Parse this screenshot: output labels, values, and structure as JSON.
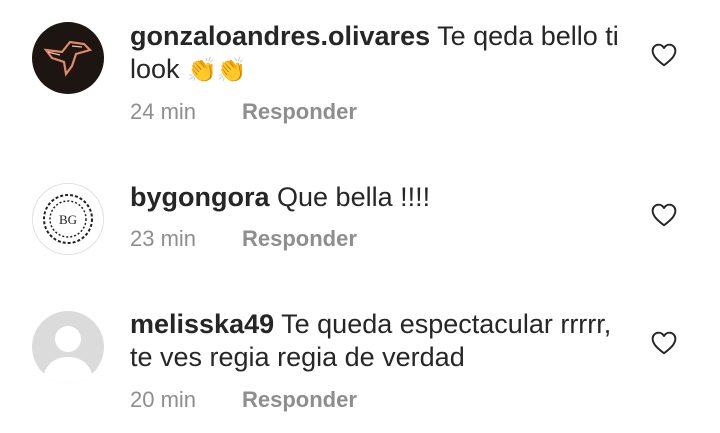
{
  "comments": [
    {
      "username": "gonzaloandres.olivares",
      "text": "Te qeda bello ti look",
      "emoji": "👏👏",
      "time": "24 min",
      "reply_label": "Responder",
      "avatar": "dark-bird-logo"
    },
    {
      "username": "bygongora",
      "text": "Que bella !!!!",
      "time": "23 min",
      "reply_label": "Responder",
      "avatar": "bg-monogram",
      "avatar_text": "BG"
    },
    {
      "username": "melisska49",
      "text": "Te queda espectacular rrrrr, te ves regia regia de verdad",
      "time": "20 min",
      "reply_label": "Responder",
      "avatar": "default-user-silhouette"
    }
  ],
  "icons": {
    "like": "heart-outline-icon"
  },
  "colors": {
    "username": "#262626",
    "meta": "#8e8e8e",
    "heart": "#262626"
  }
}
